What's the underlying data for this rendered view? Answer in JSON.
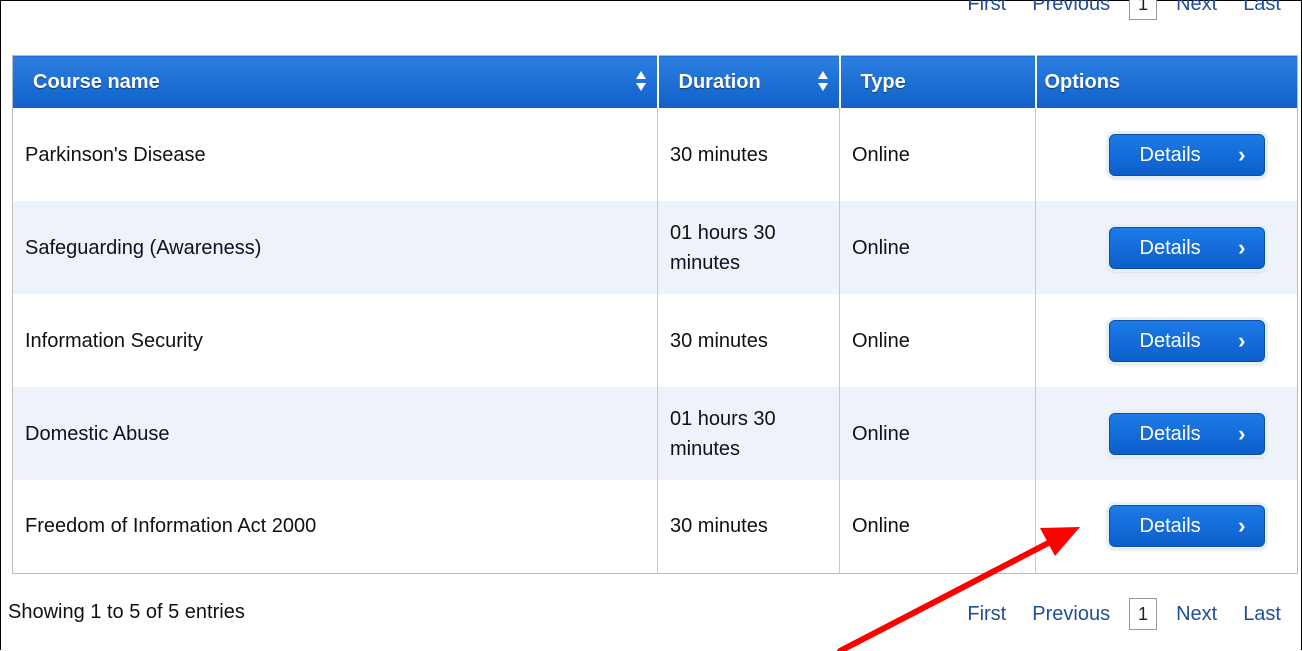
{
  "pager_top": {
    "first": "First",
    "previous": "Previous",
    "current": "1",
    "next": "Next",
    "last": "Last"
  },
  "pager_bottom": {
    "first": "First",
    "previous": "Previous",
    "current": "1",
    "next": "Next",
    "last": "Last"
  },
  "table": {
    "columns": [
      "Course name",
      "Duration",
      "Type",
      "Options"
    ],
    "rows": [
      {
        "name": "Parkinson's Disease",
        "duration": "30 minutes",
        "type": "Online",
        "option": "Details"
      },
      {
        "name": "Safeguarding (Awareness)",
        "duration": "01 hours 30 minutes",
        "type": "Online",
        "option": "Details"
      },
      {
        "name": "Information Security",
        "duration": "30 minutes",
        "type": "Online",
        "option": "Details"
      },
      {
        "name": "Domestic Abuse",
        "duration": "01 hours 30 minutes",
        "type": "Online",
        "option": "Details"
      },
      {
        "name": "Freedom of Information Act 2000",
        "duration": "30 minutes",
        "type": "Online",
        "option": "Details"
      }
    ]
  },
  "footer": {
    "showing": "Showing 1 to 5 of 5 entries"
  },
  "icons": {
    "sort": "sort-icon",
    "chevron": "chevron-right-icon",
    "annotation": "red-arrow-annotation"
  },
  "colors": {
    "header_blue": "#1a6fd8",
    "link_blue": "#1f4f9a",
    "alt_row": "#eef3fb",
    "annotation": "#ff0000"
  }
}
